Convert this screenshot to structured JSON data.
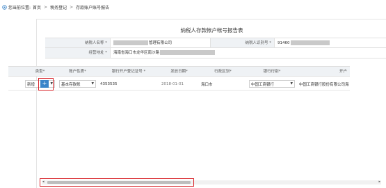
{
  "breadcrumb": {
    "location_label": "您当前位置:",
    "items": [
      "首页",
      "税务登记",
      "存款账户账号报告"
    ],
    "separator": ">"
  },
  "form": {
    "title": "纳税人存款帐户帐号报告表",
    "taxpayer_name_label": "纳税人名称 *",
    "taxpayer_name_value": "管理有限公司",
    "taxpayer_id_label": "纳税人识别号 *",
    "taxpayer_id_value": "91460",
    "address_label": "经营地址 *",
    "address_value": "海南省海口市龙华区南沙路"
  },
  "grid": {
    "columns": [
      "类型*",
      "账户性质*",
      "银行开户登记证号 *",
      "发放日期*",
      "行政区划*",
      "银行行别*",
      "开户"
    ],
    "rows": [
      {
        "type": "新增",
        "account_nature": "基本存款账",
        "license_no": "4353535",
        "issue_date": "2018-01-01",
        "region": "海口市",
        "bank_category": "中国工商银行",
        "bank_name": "中国工商银行股份有限公司海"
      }
    ],
    "add_button_label": "+"
  },
  "colors": {
    "accent": "#3a84c9",
    "highlight_border": "#d9262c",
    "header_bg": "#eff2f5"
  }
}
